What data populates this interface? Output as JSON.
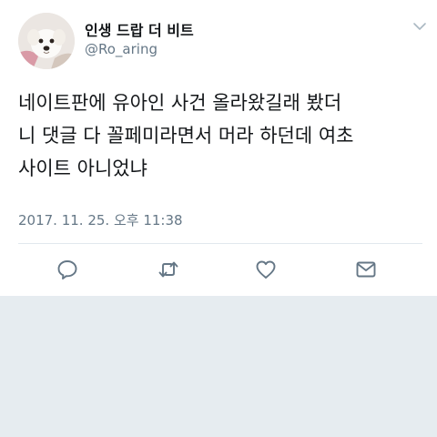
{
  "profile": {
    "display_name": "인생 드랍 더 비트",
    "handle": "@Ro_aring",
    "avatar_icon": "dog-avatar-icon"
  },
  "tweet": {
    "lines": [
      "네이트판에 유아인 사건 올라왔길래 봤더",
      "니 댓글 다 꼴페미라면서 머라 하던데 여초",
      "사이트 아니었냐"
    ],
    "timestamp": "2017. 11. 25. 오후 11:38"
  },
  "actions": [
    {
      "name": "reply-icon"
    },
    {
      "name": "retweet-icon"
    },
    {
      "name": "like-icon"
    },
    {
      "name": "direct-message-icon"
    }
  ],
  "colors": {
    "text": "#14171a",
    "secondary": "#657786",
    "icon": "#657786",
    "background": "#e6ecf0",
    "card": "#ffffff",
    "divider": "#e1e8ed"
  }
}
